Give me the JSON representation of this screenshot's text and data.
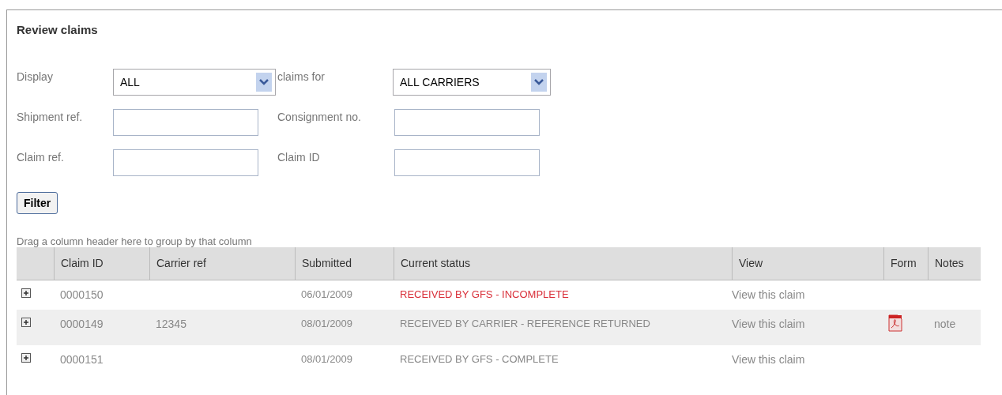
{
  "title": "Review claims",
  "filters": {
    "display": {
      "label": "Display",
      "value": "ALL"
    },
    "claims_for": {
      "label": "claims for",
      "value": "ALL CARRIERS"
    },
    "fields": [
      {
        "label": "Shipment ref."
      },
      {
        "label": "Consignment no."
      },
      {
        "label": "Claim ref."
      },
      {
        "label": "Claim ID"
      }
    ]
  },
  "filter_button": "Filter",
  "group_hint": "Drag a column header here to group by that column",
  "table": {
    "columns": [
      "Claim ID",
      "Carrier ref",
      "Submitted",
      "Current status",
      "View",
      "Form",
      "Notes"
    ],
    "rows": [
      {
        "claim_id": "0000150",
        "carrier_ref": "",
        "submitted": "06/01/2009",
        "status": "RECEIVED BY GFS - INCOMPLETE",
        "alert": true,
        "view": "View this claim",
        "form": false,
        "notes": ""
      },
      {
        "claim_id": "0000149",
        "carrier_ref": "12345",
        "submitted": "08/01/2009",
        "status": "RECEIVED BY CARRIER - REFERENCE RETURNED",
        "alert": false,
        "view": "View this claim",
        "form": true,
        "notes": "note"
      },
      {
        "claim_id": "0000151",
        "carrier_ref": "",
        "submitted": "08/01/2009",
        "status": "RECEIVED BY GFS - COMPLETE",
        "alert": false,
        "view": "View this claim",
        "form": false,
        "notes": ""
      }
    ]
  }
}
